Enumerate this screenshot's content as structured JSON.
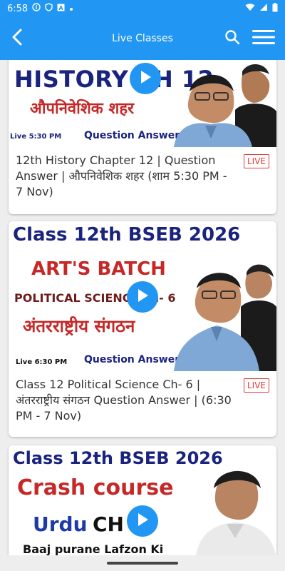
{
  "status_bar": {
    "time": "6:58",
    "icons_left": [
      "info-icon",
      "shield-icon",
      "a-icon",
      "dot-icon"
    ],
    "icons_right": [
      "wifi-icon",
      "signal-icon",
      "battery-icon"
    ]
  },
  "app_bar": {
    "title": "Live Classes",
    "back_icon": "back-arrow-icon",
    "search_icon": "search-icon",
    "menu_icon": "menu-icon"
  },
  "cards": [
    {
      "thumb": {
        "line1": "HISTORY CH 12",
        "line2": "औपनिवेशिक शहर",
        "live_time": "Live 5:30 PM",
        "qa": "Question Answer"
      },
      "caption": "12th History Chapter 12  | Question Answer |  औपनिवेशिक शहर  (शाम 5:30 PM -  7 Nov)",
      "badge": "LIVE"
    },
    {
      "thumb": {
        "line1": "Class 12th BSEB 2026",
        "line2": "ART'S BATCH",
        "line3": "POLITICAL SCIENCE Ch- 6",
        "line4": "अंतरराष्ट्रीय संगठन",
        "live_time": "Live 6:30 PM",
        "qa": "Question Answer"
      },
      "caption": "Class 12 Political Science Ch- 6 | अंतरराष्ट्रीय संगठन Question Answer | (6:30 PM - 7 Nov)",
      "badge": "LIVE"
    },
    {
      "thumb": {
        "line1": "Class 12th BSEB 2026",
        "line2": "Crash course",
        "line3a": "Urdu",
        "line3b": "CH 4",
        "line4": "Baaj purane Lafzon Ki"
      }
    }
  ],
  "colors": {
    "primary": "#2196f3",
    "live_red": "#e53935"
  }
}
